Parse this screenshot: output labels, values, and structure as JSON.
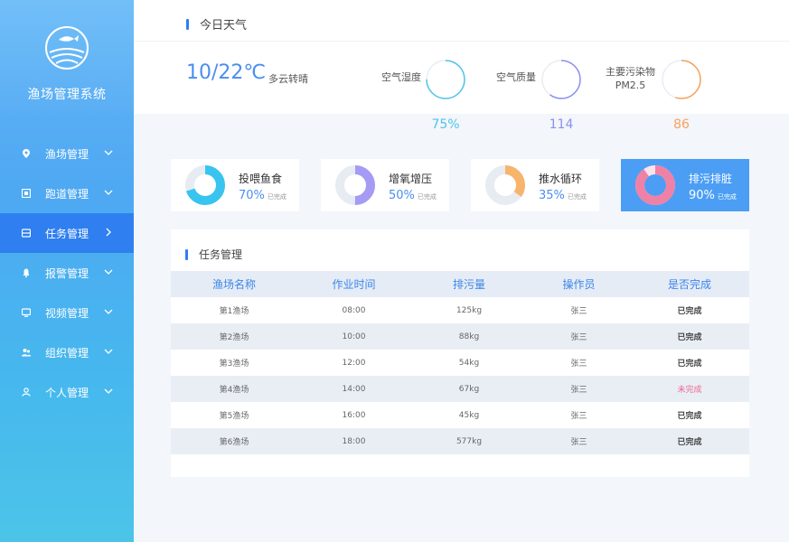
{
  "sidebar": {
    "title": "渔场管理系统",
    "logo_icon": "fish-farm-logo-icon",
    "items": [
      {
        "label": "渔场管理",
        "icon": "location-pin-icon",
        "active": false
      },
      {
        "label": "跑道管理",
        "icon": "grid-box-icon",
        "active": false
      },
      {
        "label": "任务管理",
        "icon": "task-card-icon",
        "active": true
      },
      {
        "label": "报警管理",
        "icon": "alarm-bell-icon",
        "active": false
      },
      {
        "label": "视频管理",
        "icon": "video-screen-icon",
        "active": false
      },
      {
        "label": "组织管理",
        "icon": "group-users-icon",
        "active": false
      },
      {
        "label": "个人管理",
        "icon": "user-profile-icon",
        "active": false
      }
    ]
  },
  "weather": {
    "section_title": "今日天气",
    "temperature": "10/22℃",
    "condition": "多云转晴",
    "humidity": {
      "label": "空气湿度",
      "value": "75%",
      "fraction": 0.75,
      "color": "#4fc3ea"
    },
    "air_quality": {
      "label": "空气质量",
      "value": "114",
      "fraction": 0.6,
      "color": "#8c8ff0"
    },
    "pollutant": {
      "label_line1": "主要污染物",
      "label_line2": "PM2.5",
      "value": "86",
      "fraction": 0.55,
      "color": "#f6a15c"
    }
  },
  "tasks": [
    {
      "name": "投喂鱼食",
      "percent": "70%",
      "fraction": 0.7,
      "status": "已完成",
      "color": "#38c4ef",
      "highlight": false
    },
    {
      "name": "增氧增压",
      "percent": "50%",
      "fraction": 0.5,
      "status": "已完成",
      "color": "#a59bf4",
      "highlight": false
    },
    {
      "name": "推水循环",
      "percent": "35%",
      "fraction": 0.35,
      "status": "已完成",
      "color": "#f7b46c",
      "highlight": false
    },
    {
      "name": "排污排脏",
      "percent": "90%",
      "fraction": 0.9,
      "status": "已完成",
      "color": "#f081a6",
      "highlight": true
    }
  ],
  "table": {
    "title": "任务管理",
    "headers": [
      "渔场名称",
      "作业时间",
      "排污量",
      "操作员",
      "是否完成"
    ],
    "rows": [
      [
        "第1渔场",
        "08:00",
        "125kg",
        "张三",
        "已完成"
      ],
      [
        "第2渔场",
        "10:00",
        "88kg",
        "张三",
        "已完成"
      ],
      [
        "第3渔场",
        "12:00",
        "54kg",
        "张三",
        "已完成"
      ],
      [
        "第4渔场",
        "14:00",
        "67kg",
        "张三",
        "未完成"
      ],
      [
        "第5渔场",
        "16:00",
        "45kg",
        "张三",
        "已完成"
      ],
      [
        "第6渔场",
        "18:00",
        "577kg",
        "张三",
        "已完成"
      ]
    ]
  },
  "colors": {
    "accent": "#2f7ff0",
    "text_blue": "#4a8ef0",
    "undone": "#f06690"
  }
}
